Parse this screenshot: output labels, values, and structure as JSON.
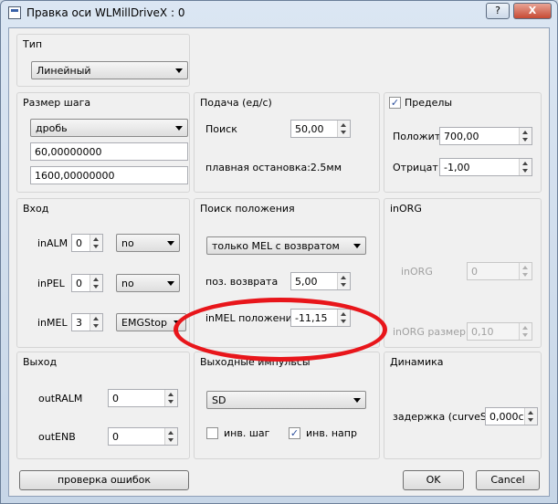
{
  "window": {
    "title": "Правка оси  WLMillDriveX : 0",
    "help_label": "?",
    "close_label": "X"
  },
  "type_group": {
    "title": "Тип",
    "value": "Линейный"
  },
  "step_group": {
    "title": "Размер шага",
    "mode": "дробь",
    "value1": "60,00000000",
    "value2": "1600,00000000"
  },
  "feed_group": {
    "title": "Подача (ед/с)",
    "search_label": "Поиск",
    "search_value": "50,00",
    "smooth_stop": "плавная остановка:2.5мм"
  },
  "limits_group": {
    "title": "Пределы",
    "checked": "✓",
    "positive_label": "Положит",
    "positive_value": "700,00",
    "negative_label": "Отрицат",
    "negative_value": "-1,00"
  },
  "input_group": {
    "title": "Вход",
    "rows": [
      {
        "label": "inALM",
        "value": "0",
        "option": "no"
      },
      {
        "label": "inPEL",
        "value": "0",
        "option": "no"
      },
      {
        "label": "inMEL",
        "value": "3",
        "option": "EMGStop"
      }
    ]
  },
  "position_group": {
    "title": "Поиск положения",
    "mode": "только MEL с возвратом",
    "return_label": "поз. возврата",
    "return_value": "5,00",
    "mel_label": "inMEL положение",
    "mel_value": "-11,15"
  },
  "inorg_group": {
    "title": "inORG",
    "inorg_label": "inORG",
    "inorg_value": "0",
    "size_label": "inORG размер",
    "size_value": "0,10"
  },
  "output_group": {
    "title": "Выход",
    "ralm_label": "outRALM",
    "ralm_value": "0",
    "enb_label": "outENB",
    "enb_value": "0"
  },
  "pulse_group": {
    "title": "Выходные импульсы",
    "mode": "SD",
    "inv_step_label": "инв. шаг",
    "inv_dir_label": "инв. напр",
    "inv_dir_checked": "✓"
  },
  "dynamics_group": {
    "title": "Динамика",
    "delay_label": "задержка (curveS)",
    "delay_value": "0,000с"
  },
  "buttons": {
    "check_errors": "проверка ошибок",
    "ok": "OK",
    "cancel": "Cancel"
  },
  "colors": {
    "annotation": "#e8161b",
    "accent": "#2b4f9c"
  }
}
